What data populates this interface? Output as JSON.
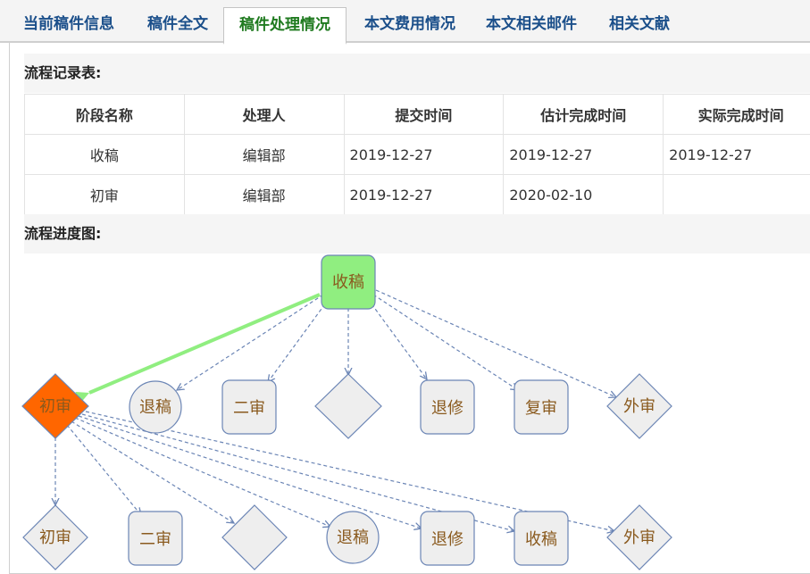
{
  "tabs": [
    {
      "label": "当前稿件信息",
      "active": false
    },
    {
      "label": "稿件全文",
      "active": false
    },
    {
      "label": "稿件处理情况",
      "active": true
    },
    {
      "label": "本文费用情况",
      "active": false
    },
    {
      "label": "本文相关邮件",
      "active": false
    },
    {
      "label": "相关文献",
      "active": false
    }
  ],
  "record": {
    "title": "流程记录表:",
    "headers": [
      "阶段名称",
      "处理人",
      "提交时间",
      "估计完成时间",
      "实际完成时间"
    ],
    "rows": [
      [
        "收稿",
        "编辑部",
        "2019-12-27",
        "2019-12-27",
        "2019-12-27"
      ],
      [
        "初审",
        "编辑部",
        "2019-12-27",
        "2020-02-10",
        ""
      ]
    ]
  },
  "progress": {
    "title": "流程进度图:",
    "nodes": {
      "root": "收稿",
      "current": "初审",
      "row1": [
        "退稿",
        "二审",
        "",
        "退修",
        "复审",
        "外审"
      ],
      "row2": [
        "初审",
        "二审",
        "",
        "退稿",
        "退修",
        "收稿",
        "外审"
      ]
    }
  },
  "colors": {
    "active_tab_text": "#1f7a1f",
    "tab_text": "#1b4f8a",
    "root_fill": "#90ee80",
    "current_fill": "#ff6600",
    "node_fill": "#eeeeee",
    "node_stroke": "#6b85b5",
    "current_edge": "#90ee80",
    "edge": "#6b85b5"
  }
}
